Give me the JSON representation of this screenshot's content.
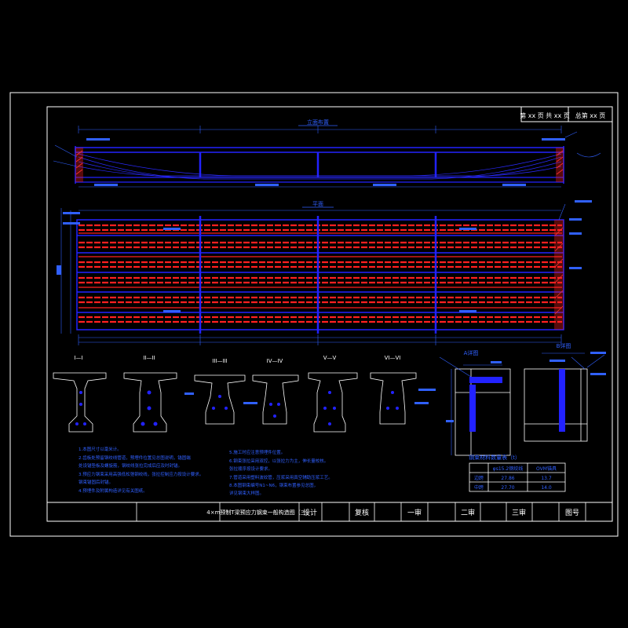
{
  "header": {
    "page_info": "第 xx 页  共 xx 页",
    "sheet_info": "总第  xx  页"
  },
  "views": {
    "elevation_title": "立面布置",
    "plan_title": "平面"
  },
  "sections": {
    "labels": [
      "I—I",
      "II—II",
      "III—III",
      "IV—IV",
      "V—V",
      "VI—VI"
    ],
    "detail_a": "A详图",
    "detail_b": "B详图"
  },
  "notes_left": [
    "1.本图尺寸以毫米计。",
    "2.齿板处预留钢绞线管道，预埋件位置见总图说明，锚固端",
    "  处设锚垫板及螺旋筋，钢绞线张拉完成后应及时封锚。",
    "3.预应力钢束采用高强低松弛钢绞线，张拉控制应力按设计要求。",
    "  钢束锚固后封锚。",
    "4.预埋件及附属构造详见有关图纸。"
  ],
  "notes_right": [
    "5.施工时应注意预埋件位置。",
    "6.钢束张拉采用双控，以张拉力为主，伸长量校核。",
    "  张拉顺序按设计要求。",
    "7.管道采用塑料波纹管，压浆采用真空辅助压浆工艺。",
    "8.本图钢束编号N1~N6，钢束布置参见总图，",
    "  详见钢束大样图。"
  ],
  "material_table": {
    "title": "钢束材料数量表（t）",
    "headers": [
      "",
      "φs15.2钢绞线",
      "OVM锚具"
    ],
    "rows": [
      [
        "边跨",
        "27.86",
        "13.7"
      ],
      [
        "中跨",
        "27.70",
        "14.0"
      ]
    ]
  },
  "title_block": {
    "drawing_title": "4×m预制T梁预应力钢束一般构造图（三）",
    "design": "设计",
    "recheck": "复核",
    "review1": "一审",
    "review2": "二审",
    "review3": "三审",
    "drawing_no": "图号"
  },
  "colors": {
    "background": "#000000",
    "border": "#ffffff",
    "structure": "#1a1aff",
    "tendon": "#ff2020",
    "annotation": "#3060ff"
  }
}
